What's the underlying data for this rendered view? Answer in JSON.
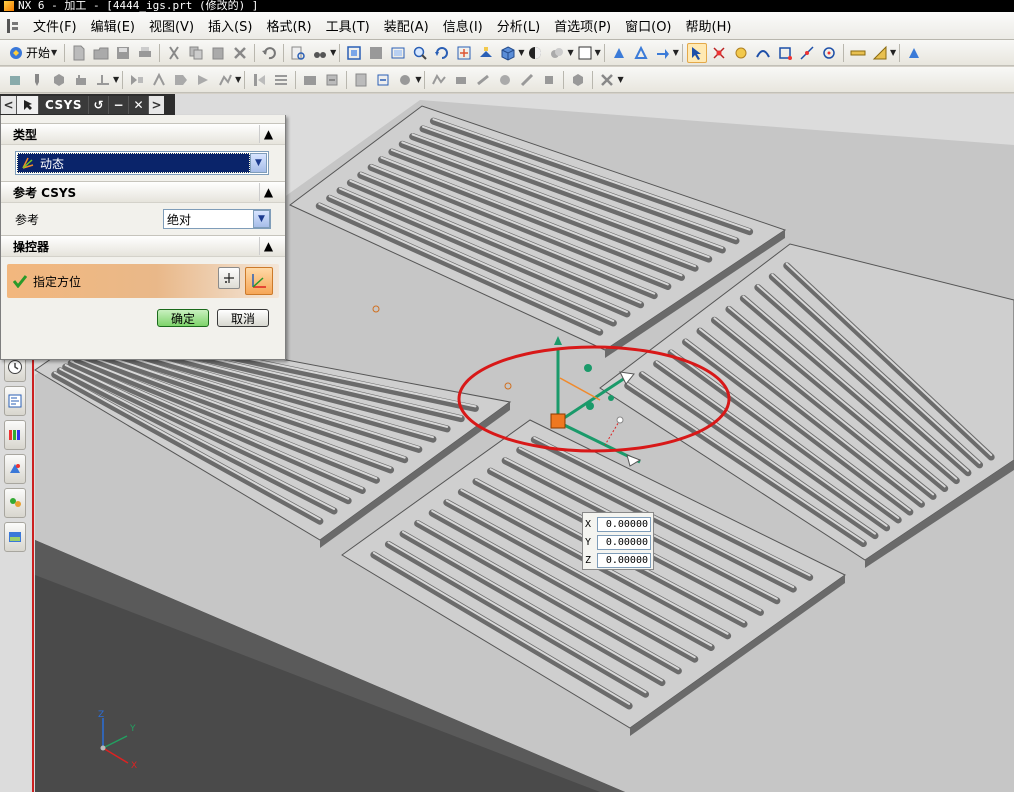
{
  "window": {
    "title": "NX 6 - 加工 - [4444_igs.prt (修改的) ]"
  },
  "menu": [
    "文件(F)",
    "编辑(E)",
    "视图(V)",
    "插入(S)",
    "格式(R)",
    "工具(T)",
    "装配(A)",
    "信息(I)",
    "分析(L)",
    "首选项(P)",
    "窗口(O)",
    "帮助(H)"
  ],
  "toolbar": {
    "start_label": "开始"
  },
  "dialog": {
    "title": "CSYS",
    "type_section": "类型",
    "type_value": "动态",
    "ref_section": "参考 CSYS",
    "ref_label": "参考",
    "ref_value": "绝对",
    "manip_section": "操控器",
    "specify_orientation": "指定方位",
    "ok": "确定",
    "cancel": "取消"
  },
  "coords": {
    "x_label": "X",
    "x_value": "0.00000",
    "y_label": "Y",
    "y_value": "0.00000",
    "z_label": "Z",
    "z_value": "0.00000"
  },
  "triad": {
    "x": "X",
    "y": "Y",
    "z": "Z"
  },
  "colors": {
    "highlight_circle": "#d81818",
    "selection": "#0a246a",
    "manip_accent": "#f08a2c"
  }
}
